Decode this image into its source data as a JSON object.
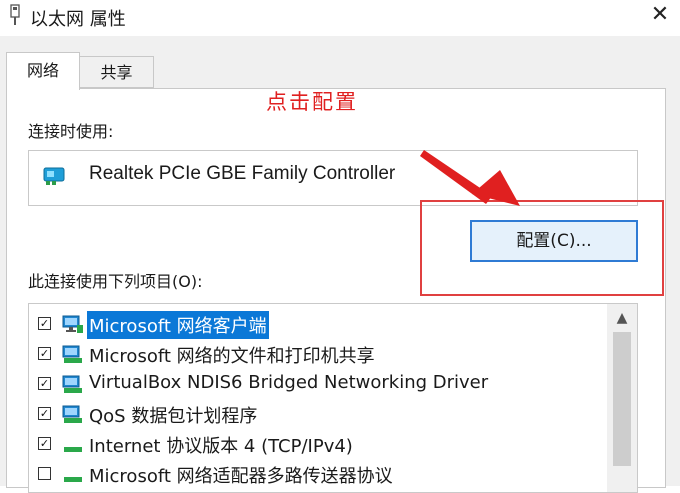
{
  "window": {
    "title": "以太网 属性",
    "close_glyph": "✕"
  },
  "tabs": [
    {
      "label": "网络",
      "active": true
    },
    {
      "label": "共享",
      "active": false
    }
  ],
  "connect_using_label": "连接时使用:",
  "adapter": {
    "name": "Realtek PCIe GBE Family Controller",
    "icon": "network-adapter-icon"
  },
  "annotation": {
    "text": "点击配置",
    "color": "#e02020"
  },
  "configure_button": {
    "label": "配置(C)..."
  },
  "items_label": "此连接使用下列项目(O):",
  "items": [
    {
      "label": "Microsoft 网络客户端",
      "checked": true,
      "selected": true,
      "icon": "network-client-icon"
    },
    {
      "label": "Microsoft 网络的文件和打印机共享",
      "checked": true,
      "selected": false,
      "icon": "network-service-icon"
    },
    {
      "label": "VirtualBox NDIS6 Bridged Networking Driver",
      "checked": true,
      "selected": false,
      "icon": "network-service-icon"
    },
    {
      "label": "QoS 数据包计划程序",
      "checked": true,
      "selected": false,
      "icon": "network-service-icon"
    },
    {
      "label": "Internet 协议版本 4 (TCP/IPv4)",
      "checked": true,
      "selected": false,
      "icon": "protocol-icon"
    },
    {
      "label": "Microsoft 网络适配器多路传送器协议",
      "checked": false,
      "selected": false,
      "icon": "protocol-icon"
    }
  ],
  "scrollbar": {
    "up_glyph": "▲"
  },
  "colors": {
    "selection": "#0b78d7",
    "highlight_frame": "#e04040",
    "button_border": "#2f7bd4"
  }
}
